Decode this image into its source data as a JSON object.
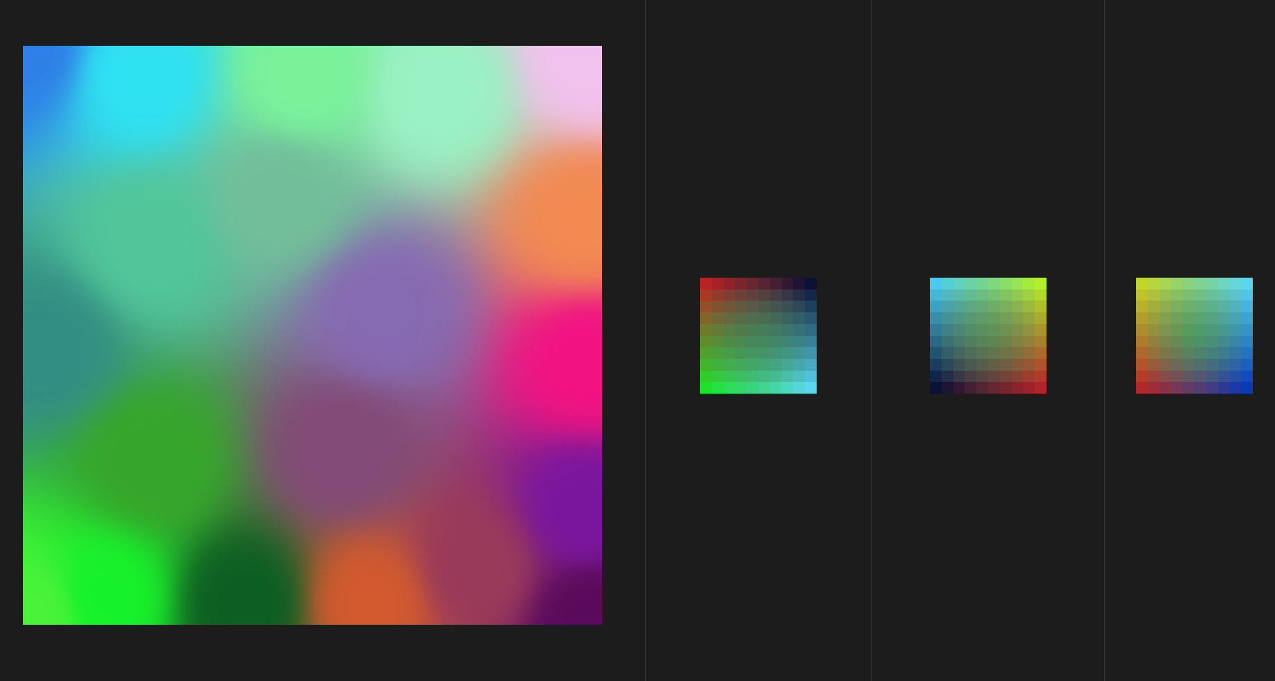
{
  "main_image": {
    "blobs": [
      {
        "c": "#2f7fe6",
        "u": 0.0,
        "v": 0.0
      },
      {
        "c": "#2fe2f2",
        "u": 0.2,
        "v": 0.05
      },
      {
        "c": "#7af29a",
        "u": 0.48,
        "v": 0.05
      },
      {
        "c": "#9af2c4",
        "u": 0.72,
        "v": 0.08
      },
      {
        "c": "#f2c2ee",
        "u": 0.98,
        "v": 0.02
      },
      {
        "c": "#52c69a",
        "u": 0.22,
        "v": 0.34
      },
      {
        "c": "#72be9a",
        "u": 0.44,
        "v": 0.26
      },
      {
        "c": "#f28a52",
        "u": 0.97,
        "v": 0.3
      },
      {
        "c": "#328e82",
        "u": 0.04,
        "v": 0.52
      },
      {
        "c": "#866ab2",
        "u": 0.62,
        "v": 0.46
      },
      {
        "c": "#f21282",
        "u": 0.98,
        "v": 0.55
      },
      {
        "c": "#36a62a",
        "u": 0.22,
        "v": 0.72
      },
      {
        "c": "#824a76",
        "u": 0.55,
        "v": 0.7
      },
      {
        "c": "#7a169e",
        "u": 0.97,
        "v": 0.8
      },
      {
        "c": "#4af23a",
        "u": 0.02,
        "v": 0.98
      },
      {
        "c": "#16f22a",
        "u": 0.14,
        "v": 0.95
      },
      {
        "c": "#0c5e22",
        "u": 0.38,
        "v": 0.96
      },
      {
        "c": "#d25a2e",
        "u": 0.6,
        "v": 0.96
      },
      {
        "c": "#9a3a5a",
        "u": 0.78,
        "v": 0.9
      },
      {
        "c": "#5a0a5a",
        "u": 0.98,
        "v": 0.99
      }
    ]
  },
  "thumbnails": [
    {
      "name": "thumbnail-1",
      "corners": {
        "tl": "#b82424",
        "tr": "#0c1236",
        "bl": "#1ee22a",
        "br": "#5ad6ee"
      },
      "mid": "#3c8a56"
    },
    {
      "name": "thumbnail-2",
      "corners": {
        "tl": "#4acaee",
        "tr": "#b2ee2a",
        "bl": "#0a1236",
        "br": "#b22428"
      },
      "mid": "#4a9a56"
    },
    {
      "name": "thumbnail-3",
      "corners": {
        "tl": "#c2d62a",
        "tr": "#5ad6ee",
        "bl": "#b22a28",
        "br": "#0a3ab6"
      },
      "mid": "#2aaa46"
    }
  ]
}
